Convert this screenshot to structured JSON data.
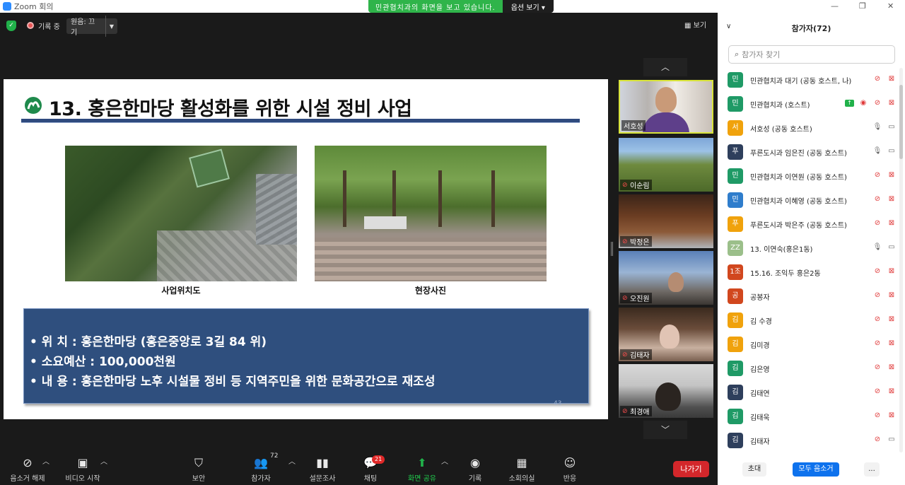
{
  "window": {
    "title": "Zoom 회의",
    "share_banner": "민관협치과의 화면을 보고 있습니다.",
    "view_options": "옵션 보기 ▾"
  },
  "topbar": {
    "recording_label": "기록 중",
    "audio_label": "원음: 끄기",
    "view_label": "보기"
  },
  "slide": {
    "title": "13. 홍은한마당 활성화를 위한 시설 정비 사업",
    "caption_left": "사업위치도",
    "caption_right": "현장사진",
    "lines": [
      "•  위      치 : 홍은한마당 (홍은중앙로 3길 84 위)",
      "•  소요예산 : 100,000천원",
      "•  내      용 : 홍은한마당 노후 시설물 정비 등 지역주민을 위한 문화공간으로 재조성"
    ],
    "page_number": "43"
  },
  "video_tiles": [
    {
      "name": "서호성",
      "muted": false
    },
    {
      "name": "이순림",
      "muted": true
    },
    {
      "name": "박정은",
      "muted": true
    },
    {
      "name": "오진원",
      "muted": true
    },
    {
      "name": "김태자",
      "muted": true
    },
    {
      "name": "최경애",
      "muted": true
    }
  ],
  "panel": {
    "title": "참가자(72)",
    "search_placeholder": "참가자 찾기",
    "participants": [
      {
        "avatar": "민",
        "color": "#1f9a66",
        "name": "민관협치과 대기 (공동 호스트, 나)",
        "mic": "muted",
        "video": "off"
      },
      {
        "avatar": "민",
        "color": "#1f9a66",
        "name": "민관협치과 (호스트)",
        "mic": "muted",
        "video": "off",
        "sharing": true,
        "recording": true
      },
      {
        "avatar": "서",
        "color": "#f0a20c",
        "name": "서호성 (공동 호스트)",
        "mic": "on",
        "video": "on"
      },
      {
        "avatar": "푸",
        "color": "#2e3f5c",
        "name": "푸른도시과 임은진 (공동 호스트)",
        "mic": "on",
        "video": "on"
      },
      {
        "avatar": "민",
        "color": "#1f9a66",
        "name": "민관협치과 이연원 (공동 호스트)",
        "mic": "muted",
        "video": "off"
      },
      {
        "avatar": "민",
        "color": "#2f7dcc",
        "name": "민관협치과 이혜영 (공동 호스트)",
        "mic": "muted",
        "video": "off"
      },
      {
        "avatar": "푸",
        "color": "#f0a20c",
        "name": "푸른도시과 박은주 (공동 호스트)",
        "mic": "muted",
        "video": "off"
      },
      {
        "avatar": "ZZ",
        "color": "#9bbf8a",
        "name": "13. 이연숙(홍은1동)",
        "mic": "on",
        "video": "on"
      },
      {
        "avatar": "1조",
        "color": "#d1471e",
        "name": "15.16. 조익두 홍은2동",
        "mic": "muted",
        "video": "off"
      },
      {
        "avatar": "공",
        "color": "#d1471e",
        "name": "공봉자",
        "mic": "muted",
        "video": "off"
      },
      {
        "avatar": "김",
        "color": "#f0a20c",
        "name": "김 수경",
        "mic": "muted",
        "video": "off"
      },
      {
        "avatar": "김",
        "color": "#f0a20c",
        "name": "김미경",
        "mic": "muted",
        "video": "off"
      },
      {
        "avatar": "김",
        "color": "#1f9a66",
        "name": "김은영",
        "mic": "muted",
        "video": "off"
      },
      {
        "avatar": "김",
        "color": "#2e3f5c",
        "name": "김태연",
        "mic": "muted",
        "video": "off"
      },
      {
        "avatar": "김",
        "color": "#1f9a66",
        "name": "김태욱",
        "mic": "muted",
        "video": "off"
      },
      {
        "avatar": "김",
        "color": "#2e3f5c",
        "name": "김태자",
        "mic": "muted",
        "video": "on"
      }
    ],
    "invite_label": "초대",
    "mute_all_label": "모두 음소거",
    "more_label": "..."
  },
  "toolbar": {
    "unmute": "음소거 해제",
    "start_video": "비디오 시작",
    "security": "보안",
    "participants": "참가자",
    "participants_count": "72",
    "polls": "설문조사",
    "chat": "채팅",
    "chat_badge": "21",
    "share_screen": "화면 공유",
    "record": "기록",
    "breakout": "소회의실",
    "reactions": "반응",
    "leave": "나가기"
  }
}
